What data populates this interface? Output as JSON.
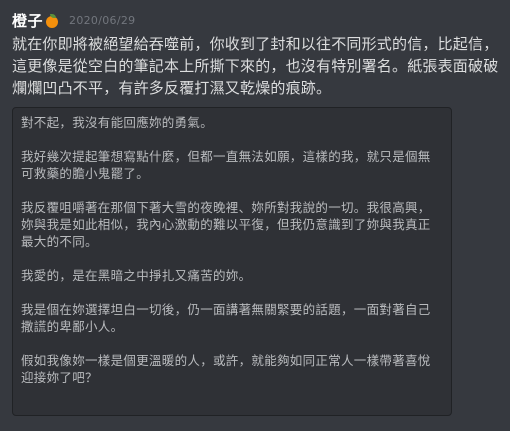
{
  "message": {
    "username": "橙子",
    "timestamp": "2020/06/29",
    "badge_icon": "orange-emoji",
    "text": "就在你即將被絕望給吞噬前，你收到了封和以往不同形式的信，比起信，這更像是從空白的筆記本上所撕下來的，也沒有特別署名。紙張表面破破爛爛凹凸不平，有許多反覆打濕又乾燥的痕跡。",
    "codeblock_paragraphs": [
      "對不起，我沒有能回應妳的勇氣。",
      "我好幾次提起筆想寫點什麼，但都一直無法如願，這樣的我，就只是個無可救藥的膽小鬼罷了。",
      "我反覆咀嚼著在那個下著大雪的夜晚裡、妳所對我說的一切。我很高興，妳與我是如此相似，我內心激動的難以平復，但我仍意識到了妳與我真正最大的不同。",
      "我愛的，是在黑暗之中掙扎又痛苦的妳。",
      "我是個在妳選擇坦白一切後，仍一面講著無關緊要的話題，一面對著自己撒謊的卑鄙小人。",
      "假如我像妳一樣是個更溫暖的人，或許，就能夠如同正常人一樣帶著喜悅迎接妳了吧？"
    ]
  }
}
